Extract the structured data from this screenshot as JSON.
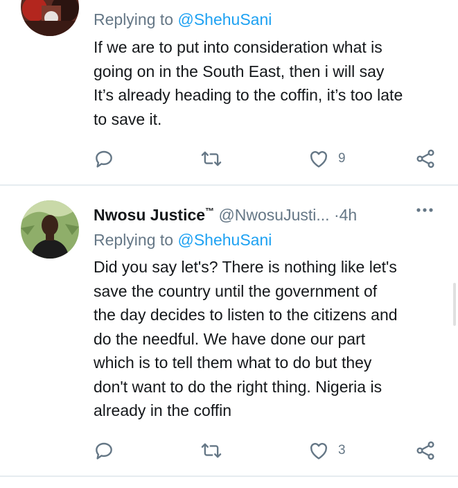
{
  "colors": {
    "link": "#1da1f2",
    "muted": "#657786",
    "text": "#14171a",
    "divider": "#e6ecf0"
  },
  "tweets": [
    {
      "replying_prefix": "Replying to",
      "replying_to": "@ShehuSani",
      "text_lines": [
        "If we are to put into consideration what is",
        "going on in the South East, then i will say",
        "It’s already heading to the coffin, it’s too late",
        "to save it."
      ],
      "likes": "9",
      "icons": [
        "reply-icon",
        "retweet-icon",
        "like-icon",
        "share-icon"
      ]
    },
    {
      "name": "Nwosu Justice",
      "name_mark": "™",
      "handle": "@NwosuJusti...",
      "separator": "·",
      "time": "4h",
      "replying_prefix": "Replying to",
      "replying_to": "@ShehuSani",
      "text_lines": [
        "Did you say let's? There is nothing like let's",
        "save the country until the government of",
        "the day decides to listen to the citizens and",
        "do the needful. We have done our part",
        "which is to tell them what to do but they",
        "don't want to do the right thing. Nigeria is",
        "already in the coffin"
      ],
      "likes": "3",
      "icons": [
        "avatar",
        "more-icon",
        "reply-icon",
        "retweet-icon",
        "like-icon",
        "share-icon"
      ]
    }
  ]
}
